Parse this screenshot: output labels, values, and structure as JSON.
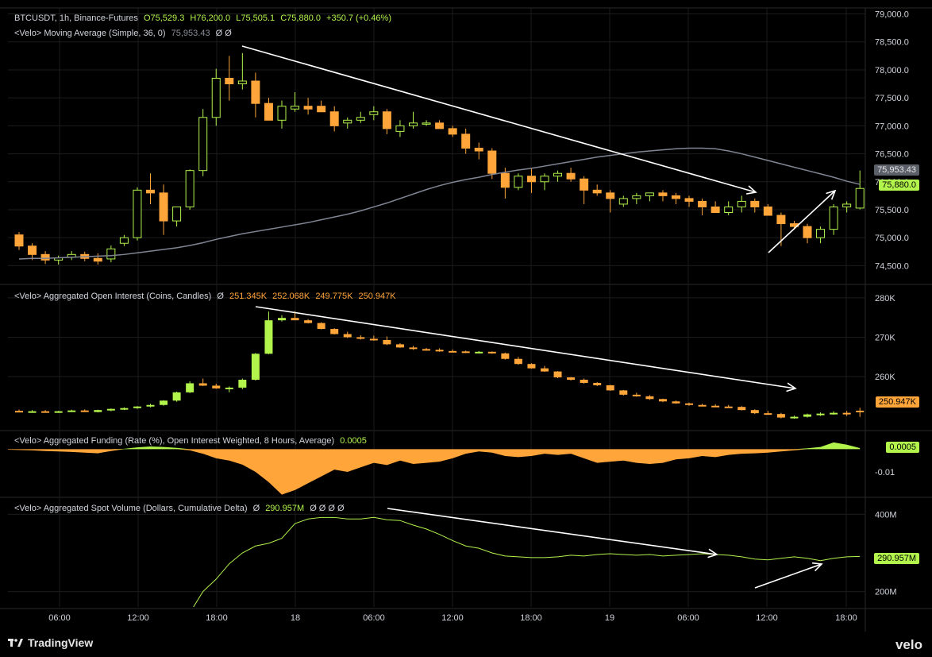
{
  "header": {
    "symbol": "BTCUSDT, 1h, Binance-Futures",
    "o": "O75,529.3",
    "h": "H76,200.0",
    "l": "L75,505.1",
    "c": "C75,880.0",
    "chg": "+350.7 (+0.46%)",
    "ma_label": "<Velo> Moving Average (Simple, 36, 0)",
    "ma_value": "75,953.43",
    "ma_flags": "Ø  Ø"
  },
  "panes": {
    "oi": {
      "label": "<Velo> Aggregated Open Interest (Coins, Candles)",
      "flag": "Ø",
      "v1": "251.345K",
      "v2": "252.068K",
      "v3": "249.775K",
      "v4": "250.947K"
    },
    "funding": {
      "label": "<Velo> Aggregated Funding (Rate (%), Open Interest Weighted, 8 Hours, Average)",
      "value": "0.0005"
    },
    "spot": {
      "label": "<Velo> Aggregated Spot Volume (Dollars, Cumulative Delta)",
      "flag": "Ø",
      "value": "290.957M",
      "flags": "Ø  Ø  Ø  Ø"
    }
  },
  "tags": {
    "ma": "75,953.43",
    "price": "75,880.0",
    "oi": "250.947K",
    "funding": "0.0005",
    "spot": "290.957M"
  },
  "footer": {
    "tradingview": "TradingView",
    "velo": "velo"
  },
  "colors": {
    "up": "#b2f34c",
    "down": "#ffa53a",
    "ma": "#7f8593",
    "arrow": "#ffffff",
    "bg": "#000000",
    "grid": "#1c1c1c"
  },
  "chart_data": [
    {
      "type": "candlestick",
      "title": "BTCUSDT, 1h, Binance-Futures",
      "x_ticks": [
        "06:00",
        "12:00",
        "18:00",
        "18",
        "06:00",
        "12:00",
        "18:00",
        "19",
        "06:00",
        "12:00",
        "18:00"
      ],
      "y_ticks": [
        "74,500.0",
        "75,000.0",
        "75,500.0",
        "76,000.0",
        "76,500.0",
        "77,000.0",
        "77,500.0",
        "78,000.0",
        "78,500.0",
        "79,000.0"
      ],
      "ylim": [
        74250,
        79050
      ],
      "candles": [
        [
          75050,
          75100,
          74780,
          74850
        ],
        [
          74850,
          74900,
          74600,
          74700
        ],
        [
          74700,
          74760,
          74530,
          74600
        ],
        [
          74600,
          74680,
          74520,
          74640
        ],
        [
          74650,
          74760,
          74600,
          74700
        ],
        [
          74700,
          74750,
          74580,
          74630
        ],
        [
          74630,
          74720,
          74520,
          74580
        ],
        [
          74620,
          74860,
          74560,
          74800
        ],
        [
          74900,
          75050,
          74850,
          75000
        ],
        [
          75000,
          75900,
          74950,
          75850
        ],
        [
          75850,
          76150,
          75600,
          75800
        ],
        [
          75800,
          75950,
          75050,
          75300
        ],
        [
          75300,
          75500,
          75200,
          75550
        ],
        [
          75550,
          76220,
          75500,
          76200
        ],
        [
          76200,
          77300,
          76100,
          77150
        ],
        [
          77150,
          78020,
          77000,
          77850
        ],
        [
          77850,
          78250,
          77450,
          77750
        ],
        [
          77750,
          78300,
          77650,
          77800
        ],
        [
          77800,
          77950,
          77150,
          77400
        ],
        [
          77400,
          77500,
          77100,
          77100
        ],
        [
          77100,
          77450,
          76950,
          77350
        ],
        [
          77300,
          77600,
          77250,
          77350
        ],
        [
          77350,
          77500,
          77200,
          77300
        ],
        [
          77350,
          77450,
          77250,
          77250
        ],
        [
          77250,
          77350,
          76900,
          77000
        ],
        [
          77050,
          77150,
          76950,
          77100
        ],
        [
          77100,
          77250,
          77050,
          77150
        ],
        [
          77200,
          77350,
          77100,
          77250
        ],
        [
          77250,
          77300,
          76850,
          76950
        ],
        [
          76900,
          77100,
          76800,
          77000
        ],
        [
          77000,
          77250,
          76950,
          77050
        ],
        [
          77050,
          77100,
          77000,
          77050
        ],
        [
          77050,
          77100,
          76950,
          76950
        ],
        [
          76950,
          77000,
          76800,
          76850
        ],
        [
          76850,
          76950,
          76500,
          76600
        ],
        [
          76600,
          76700,
          76400,
          76550
        ],
        [
          76550,
          76600,
          76050,
          76150
        ],
        [
          76150,
          76250,
          75700,
          75900
        ],
        [
          75900,
          76150,
          75850,
          76100
        ],
        [
          76100,
          76250,
          75800,
          76000
        ],
        [
          76000,
          76150,
          75850,
          76100
        ],
        [
          76100,
          76200,
          76000,
          76150
        ],
        [
          76150,
          76250,
          76000,
          76050
        ],
        [
          76050,
          76100,
          75600,
          75850
        ],
        [
          75850,
          75950,
          75750,
          75800
        ],
        [
          75800,
          75850,
          75450,
          75700
        ],
        [
          75600,
          75750,
          75550,
          75700
        ],
        [
          75700,
          75800,
          75600,
          75750
        ],
        [
          75750,
          75800,
          75650,
          75800
        ],
        [
          75800,
          75850,
          75650,
          75750
        ],
        [
          75750,
          75800,
          75600,
          75700
        ],
        [
          75700,
          75750,
          75550,
          75650
        ],
        [
          75650,
          75700,
          75400,
          75550
        ],
        [
          75550,
          75650,
          75450,
          75450
        ],
        [
          75450,
          75650,
          75400,
          75550
        ],
        [
          75550,
          75750,
          75450,
          75650
        ],
        [
          75650,
          75700,
          75450,
          75550
        ],
        [
          75550,
          75600,
          75400,
          75400
        ],
        [
          75400,
          75450,
          74850,
          75250
        ],
        [
          75250,
          75300,
          75150,
          75200
        ],
        [
          75200,
          75250,
          74900,
          75000
        ],
        [
          75000,
          75200,
          74900,
          75150
        ],
        [
          75150,
          75600,
          75050,
          75550
        ],
        [
          75550,
          75650,
          75450,
          75600
        ],
        [
          75529.3,
          76200,
          75505.1,
          75880
        ]
      ],
      "ma_name": "<Velo> Moving Average (Simple, 36, 0)",
      "ma": [
        74620,
        74630,
        74630,
        74640,
        74650,
        74660,
        74670,
        74680,
        74700,
        74730,
        74760,
        74790,
        74820,
        74860,
        74910,
        74970,
        75020,
        75070,
        75110,
        75150,
        75190,
        75230,
        75270,
        75320,
        75370,
        75420,
        75480,
        75550,
        75620,
        75700,
        75780,
        75860,
        75930,
        75990,
        76040,
        76080,
        76130,
        76170,
        76210,
        76240,
        76280,
        76320,
        76360,
        76400,
        76440,
        76470,
        76500,
        76530,
        76550,
        76570,
        76590,
        76600,
        76600,
        76590,
        76550,
        76500,
        76440,
        76380,
        76320,
        76260,
        76200,
        76140,
        76080,
        76010,
        75953.43
      ]
    },
    {
      "type": "candlestick",
      "title": "<Velo> Aggregated Open Interest (Coins, Candles)",
      "y_ticks": [
        "260K",
        "270K",
        "280K"
      ],
      "ylim": [
        247500,
        282000
      ],
      "candles": [
        [
          251.3,
          251.6,
          251.0,
          251.1
        ],
        [
          251.1,
          251.5,
          250.9,
          251.2
        ],
        [
          251.2,
          251.5,
          251.0,
          251.0
        ],
        [
          251.0,
          251.3,
          250.8,
          251.2
        ],
        [
          251.2,
          251.6,
          251.0,
          251.4
        ],
        [
          251.4,
          251.7,
          251.0,
          251.0
        ],
        [
          251.0,
          251.6,
          250.9,
          251.5
        ],
        [
          251.5,
          251.9,
          251.2,
          251.8
        ],
        [
          251.8,
          252.2,
          251.5,
          252.0
        ],
        [
          252.0,
          252.5,
          251.8,
          252.4
        ],
        [
          252.4,
          253.1,
          252.2,
          252.8
        ],
        [
          252.8,
          254.0,
          252.6,
          253.9
        ],
        [
          253.9,
          256.2,
          253.6,
          256.0
        ],
        [
          256.0,
          258.8,
          255.8,
          258.3
        ],
        [
          258.3,
          259.5,
          257.6,
          257.7
        ],
        [
          257.7,
          258.2,
          256.9,
          257.0
        ],
        [
          257.0,
          257.5,
          256.0,
          257.2
        ],
        [
          257.2,
          259.5,
          256.8,
          259.2
        ],
        [
          259.2,
          266.0,
          259.0,
          265.8
        ],
        [
          265.8,
          276.5,
          265.7,
          274.3
        ],
        [
          274.3,
          275.6,
          274.0,
          274.9
        ],
        [
          274.9,
          276.6,
          274.5,
          274.3
        ],
        [
          274.3,
          274.6,
          273.5,
          273.6
        ],
        [
          273.6,
          273.8,
          272.0,
          272.1
        ],
        [
          272.1,
          272.3,
          270.7,
          270.8
        ],
        [
          270.8,
          271.4,
          269.8,
          270.0
        ],
        [
          270.0,
          270.5,
          269.4,
          269.6
        ],
        [
          269.6,
          270.4,
          269.1,
          269.3
        ],
        [
          269.3,
          270.2,
          268.0,
          268.2
        ],
        [
          268.2,
          268.5,
          267.3,
          267.4
        ],
        [
          267.4,
          267.8,
          266.8,
          267.0
        ],
        [
          267.0,
          267.3,
          266.6,
          266.8
        ],
        [
          266.8,
          267.2,
          266.3,
          266.5
        ],
        [
          266.5,
          266.9,
          266.2,
          266.4
        ],
        [
          266.4,
          266.6,
          266.0,
          266.1
        ],
        [
          266.1,
          266.5,
          265.9,
          266.3
        ],
        [
          266.3,
          266.4,
          265.8,
          265.9
        ],
        [
          265.9,
          266.1,
          264.3,
          264.5
        ],
        [
          264.5,
          265.0,
          263.0,
          263.2
        ],
        [
          263.2,
          263.4,
          262.0,
          262.1
        ],
        [
          262.1,
          262.7,
          261.2,
          261.3
        ],
        [
          261.3,
          261.4,
          259.6,
          259.8
        ],
        [
          259.8,
          259.9,
          259.0,
          259.2
        ],
        [
          259.2,
          259.5,
          258.2,
          258.4
        ],
        [
          258.4,
          258.6,
          257.6,
          257.8
        ],
        [
          257.8,
          257.9,
          256.4,
          256.5
        ],
        [
          256.5,
          256.6,
          255.2,
          255.4
        ],
        [
          255.4,
          255.9,
          254.9,
          255.0
        ],
        [
          255.0,
          255.3,
          254.1,
          254.3
        ],
        [
          254.3,
          254.4,
          253.5,
          253.7
        ],
        [
          253.7,
          253.9,
          253.1,
          253.2
        ],
        [
          253.2,
          253.4,
          252.6,
          252.8
        ],
        [
          252.8,
          253.1,
          252.5,
          252.6
        ],
        [
          252.6,
          253.0,
          252.3,
          252.4
        ],
        [
          252.4,
          252.8,
          252.2,
          252.3
        ],
        [
          252.3,
          252.5,
          251.4,
          251.5
        ],
        [
          251.5,
          251.7,
          250.5,
          250.7
        ],
        [
          250.7,
          251.3,
          250.3,
          250.5
        ],
        [
          250.5,
          250.8,
          249.4,
          249.6
        ],
        [
          249.6,
          250.1,
          249.3,
          249.8
        ],
        [
          249.8,
          250.6,
          249.6,
          250.4
        ],
        [
          250.4,
          250.9,
          250.0,
          250.6
        ],
        [
          250.6,
          251.2,
          250.3,
          250.8
        ],
        [
          250.8,
          251.3,
          250.0,
          250.5
        ],
        [
          251.345,
          252.068,
          249.775,
          250.947
        ]
      ]
    },
    {
      "type": "area",
      "title": "<Velo> Aggregated Funding (Rate (%), Open Interest Weighted, 8 Hours, Average)",
      "y_ticks": [
        "-0.01"
      ],
      "ylim": [
        -0.0205,
        0.0075
      ],
      "values": [
        -0.0002,
        -0.0005,
        -0.0008,
        -0.001,
        -0.0012,
        -0.0015,
        -0.0018,
        -0.0008,
        0.0002,
        0.0008,
        0.0012,
        0.001,
        0.0006,
        -0.0005,
        -0.002,
        -0.004,
        -0.005,
        -0.0068,
        -0.01,
        -0.0145,
        -0.02,
        -0.018,
        -0.015,
        -0.012,
        -0.009,
        -0.01,
        -0.008,
        -0.006,
        -0.007,
        -0.005,
        -0.0065,
        -0.006,
        -0.0055,
        -0.004,
        -0.002,
        -0.001,
        -0.0015,
        -0.003,
        -0.0035,
        -0.003,
        -0.002,
        -0.0025,
        -0.002,
        -0.004,
        -0.006,
        -0.0055,
        -0.005,
        -0.006,
        -0.0065,
        -0.006,
        -0.0045,
        -0.004,
        -0.003,
        -0.0035,
        -0.0025,
        -0.002,
        -0.0018,
        -0.0015,
        -0.001,
        -0.0005,
        0.0004,
        0.001,
        0.003,
        0.002,
        0.0005
      ]
    },
    {
      "type": "line",
      "title": "<Velo> Aggregated Spot Volume (Dollars, Cumulative Delta)",
      "y_ticks": [
        "200M",
        "400M"
      ],
      "ylim": [
        160,
        440
      ],
      "values": [
        null,
        null,
        null,
        null,
        null,
        null,
        null,
        null,
        null,
        null,
        null,
        null,
        null,
        null,
        200,
        232,
        272,
        300,
        318,
        325,
        338,
        376,
        388,
        392,
        392,
        388,
        388,
        392,
        386,
        384,
        372,
        362,
        348,
        332,
        318,
        312,
        300,
        292,
        290,
        288,
        288,
        290,
        294,
        292,
        296,
        298,
        296,
        294,
        296,
        292,
        294,
        296,
        298,
        296,
        294,
        290,
        284,
        282,
        286,
        290,
        286,
        280,
        286,
        290,
        290.957
      ]
    }
  ]
}
